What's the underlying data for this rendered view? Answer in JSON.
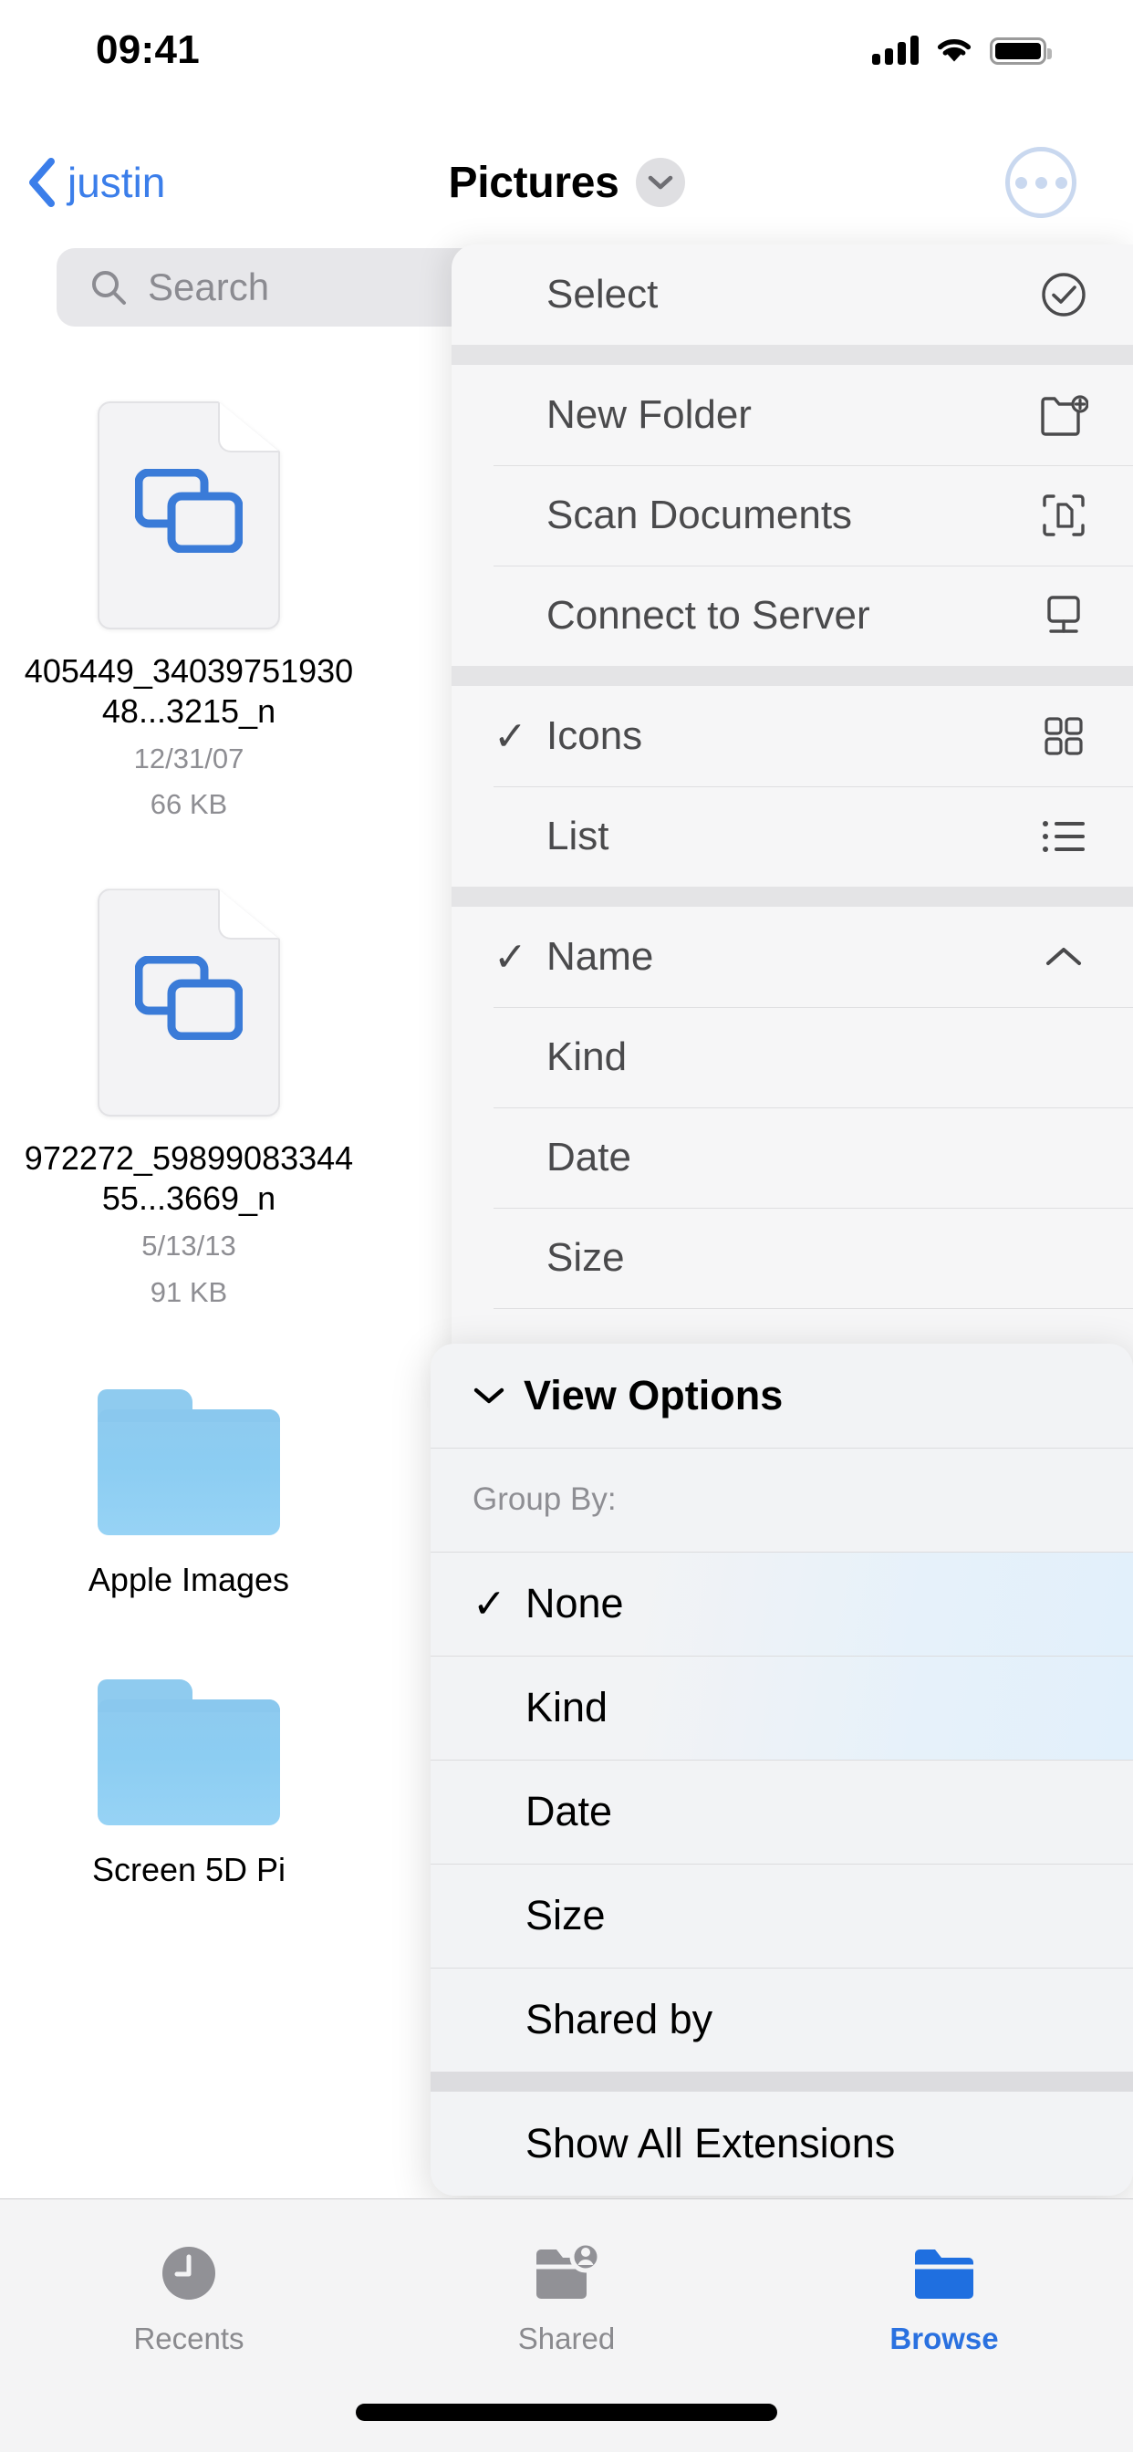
{
  "status_bar": {
    "time": "09:41",
    "signal_icon": "cellular-signal-icon",
    "wifi_icon": "wifi-icon",
    "battery_icon": "battery-full-icon"
  },
  "nav_bar": {
    "back_label": "justin",
    "back_icon": "chevron-left-icon",
    "title": "Pictures",
    "title_chevron_icon": "chevron-down-icon",
    "more_icon": "ellipsis-circle-icon"
  },
  "search": {
    "placeholder": "Search",
    "icon": "search-icon"
  },
  "files": [
    {
      "type": "file",
      "icon": "document-image-icon",
      "name": "405449_3403975193048...3215_n",
      "date": "12/31/07",
      "size": "66 KB"
    },
    {
      "type": "file",
      "icon": "document-image-icon",
      "name": "972272_5989908334455...3669_n",
      "date": "5/13/13",
      "size": "91 KB"
    },
    {
      "type": "folder",
      "icon": "folder-icon",
      "name": "Apple Images"
    },
    {
      "type": "folder",
      "icon": "folder-icon",
      "name": "Screen 5D Pi"
    }
  ],
  "context_menu": {
    "groups": [
      {
        "items": [
          {
            "label": "Select",
            "icon": "checkmark-circle-icon",
            "checked": false
          }
        ]
      },
      {
        "items": [
          {
            "label": "New Folder",
            "icon": "folder-plus-icon",
            "checked": false
          },
          {
            "label": "Scan Documents",
            "icon": "scan-document-icon",
            "checked": false
          },
          {
            "label": "Connect to Server",
            "icon": "server-display-icon",
            "checked": false
          }
        ]
      },
      {
        "items": [
          {
            "label": "Icons",
            "icon": "grid-icon",
            "checked": true
          },
          {
            "label": "List",
            "icon": "list-icon",
            "checked": false
          }
        ]
      },
      {
        "items": [
          {
            "label": "Name",
            "icon": "chevron-up-icon",
            "checked": true
          },
          {
            "label": "Kind",
            "icon": "",
            "checked": false
          },
          {
            "label": "Date",
            "icon": "",
            "checked": false
          },
          {
            "label": "Size",
            "icon": "",
            "checked": false
          }
        ]
      }
    ]
  },
  "view_options_menu": {
    "header": {
      "label": "View Options",
      "chevron_icon": "chevron-down-icon"
    },
    "section_label": "Group By:",
    "group_by_options": [
      {
        "label": "None",
        "checked": true
      },
      {
        "label": "Kind",
        "checked": false
      },
      {
        "label": "Date",
        "checked": false
      },
      {
        "label": "Size",
        "checked": false
      },
      {
        "label": "Shared by",
        "checked": false
      }
    ],
    "footer_item": {
      "label": "Show All Extensions",
      "checked": false
    }
  },
  "tab_bar": {
    "tabs": [
      {
        "label": "Recents",
        "icon": "clock-icon",
        "active": false
      },
      {
        "label": "Shared",
        "icon": "folder-person-icon",
        "active": false
      },
      {
        "label": "Browse",
        "icon": "folder-filled-icon",
        "active": true
      }
    ]
  },
  "colors": {
    "accent_blue": "#2a71e0",
    "link_blue": "#3b7eea",
    "folder_blue": "#8ecaef",
    "menu_bg": "#f6f6f7",
    "submenu_bg": "#f2f3f5",
    "secondary_text": "#8e8e93",
    "menu_text": "#4a4a4c"
  }
}
